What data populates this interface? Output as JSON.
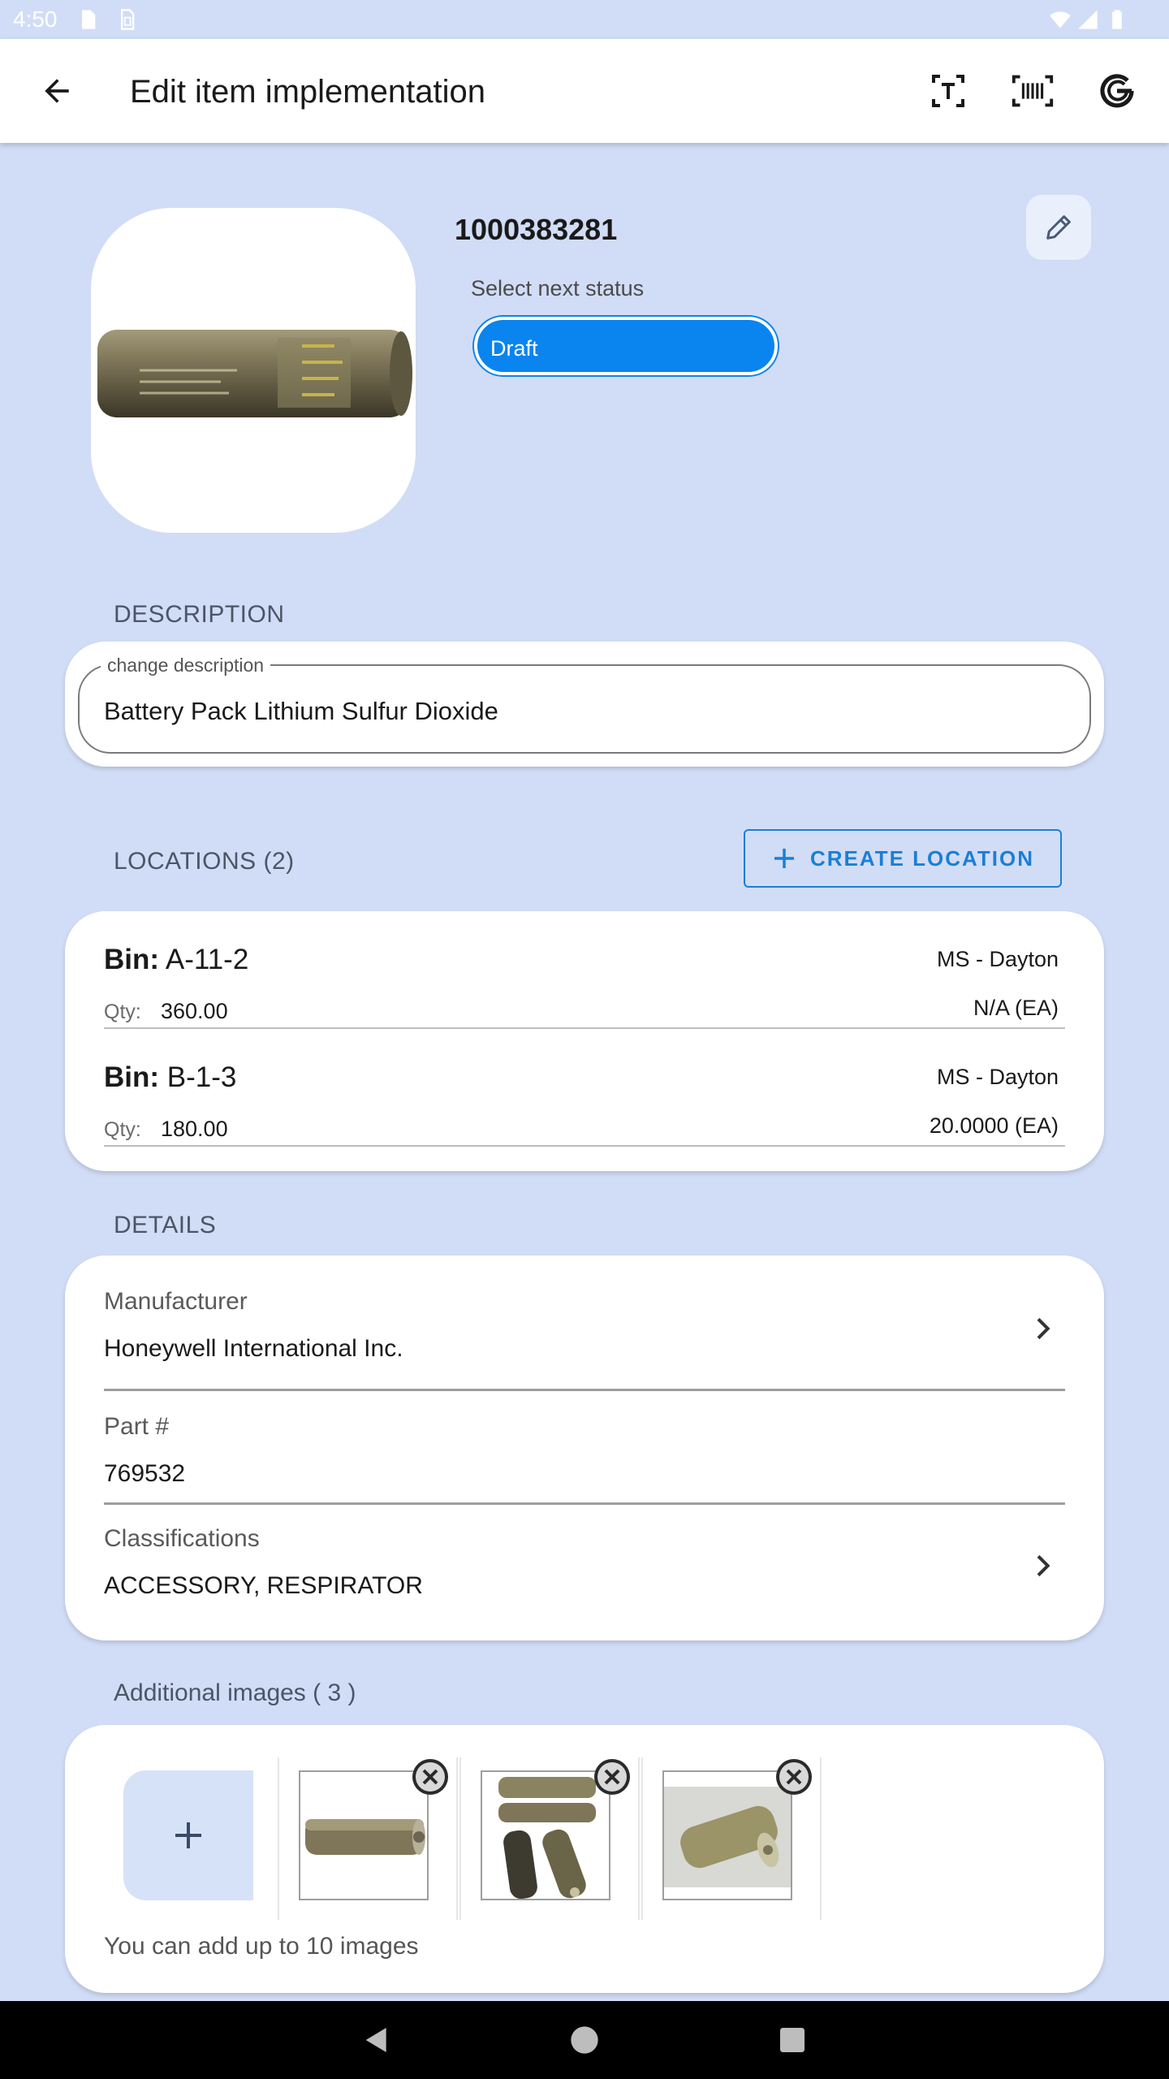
{
  "status_bar": {
    "time": "4:50",
    "icons": [
      "sd-card-icon",
      "sim-icon",
      "wifi-icon",
      "signal-icon",
      "battery-icon"
    ]
  },
  "app_bar": {
    "title": "Edit item implementation",
    "actions": [
      "text-scan-icon",
      "barcode-scan-icon",
      "google-icon"
    ]
  },
  "item": {
    "number": "1000383281",
    "status_label": "Select next status",
    "status_value": "Draft"
  },
  "description": {
    "section_title": "DESCRIPTION",
    "legend": "change description",
    "value": "Battery Pack Lithium Sulfur Dioxide"
  },
  "locations": {
    "section_title": "LOCATIONS (2)",
    "create_label": "CREATE LOCATION",
    "bin_label": "Bin:",
    "qty_label": "Qty:",
    "items": [
      {
        "bin": "A-11-2",
        "qty": "360.00",
        "site": "MS - Dayton",
        "uom": "N/A (EA)"
      },
      {
        "bin": "B-1-3",
        "qty": "180.00",
        "site": "MS - Dayton",
        "uom": "20.0000 (EA)"
      }
    ]
  },
  "details": {
    "section_title": "DETAILS",
    "manufacturer_label": "Manufacturer",
    "manufacturer_value": "Honeywell International Inc.",
    "part_label": "Part #",
    "part_value": "769532",
    "classifications_label": "Classifications",
    "classifications_value": "ACCESSORY, RESPIRATOR"
  },
  "additional_images": {
    "section_title": "Additional images ( 3 )",
    "hint": "You can add up to 10 images"
  },
  "colors": {
    "background": "#d1ddf7",
    "accent": "#0a84ee",
    "outline_button": "#1a7fd6"
  }
}
